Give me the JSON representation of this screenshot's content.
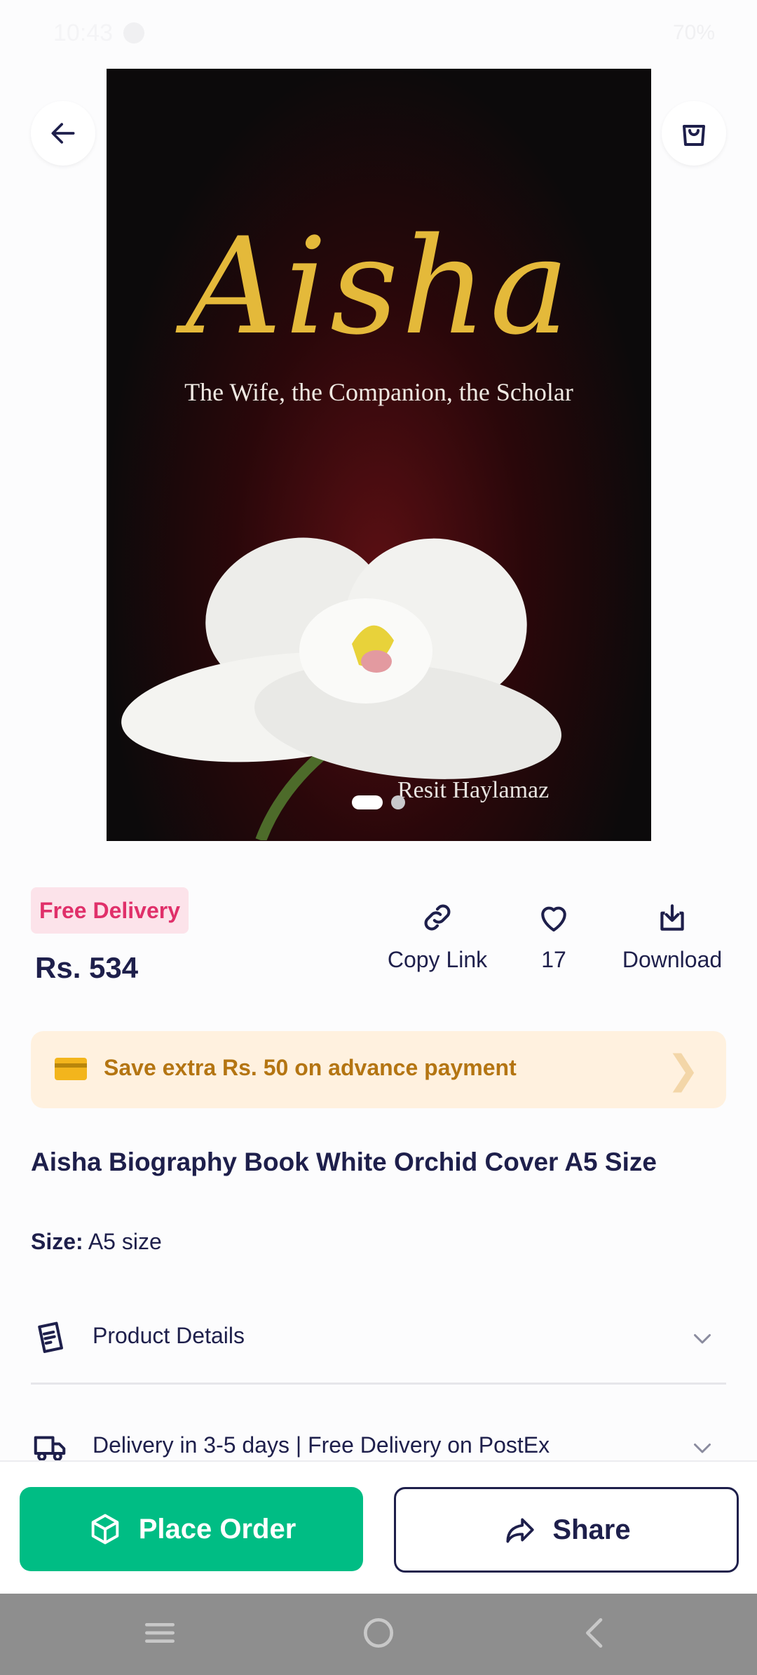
{
  "status_bar": {
    "time": "10:43",
    "battery": "70%"
  },
  "hero": {
    "title": "Aisha",
    "subtitle": "The Wife, the Companion, the Scholar",
    "author": "Resit Haylamaz",
    "image_count": 2,
    "active_index": 1
  },
  "badge": {
    "free_delivery": "Free Delivery"
  },
  "price": "Rs. 534",
  "actions": {
    "copy_link": "Copy Link",
    "likes": "17",
    "download": "Download"
  },
  "promo": {
    "text": "Save extra Rs. 50 on advance payment"
  },
  "product": {
    "title": "Aisha Biography Book White Orchid Cover A5 Size",
    "size_label": "Size:",
    "size_value": "A5 size"
  },
  "accordions": {
    "details": "Product Details",
    "delivery": "Delivery in 3-5 days | Free Delivery on PostEx"
  },
  "buttons": {
    "place_order": "Place Order",
    "share": "Share"
  },
  "colors": {
    "accent_green": "#00BD84",
    "navy": "#1E1F4B",
    "pink": "#E0306A",
    "promo_text": "#B47512"
  }
}
